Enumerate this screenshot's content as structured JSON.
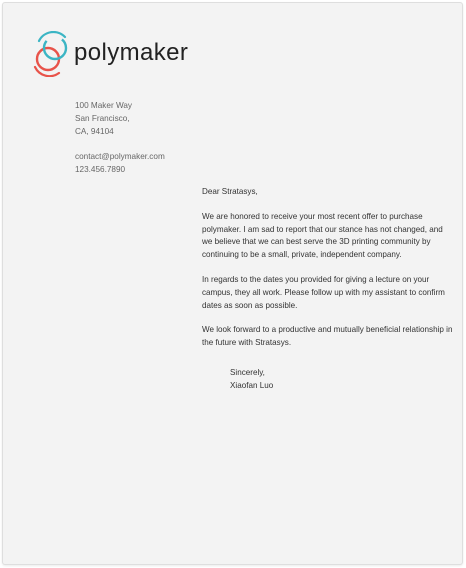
{
  "brand": {
    "name": "polymaker",
    "logo_colors": [
      "#e8534a",
      "#3bb5c4"
    ]
  },
  "address": {
    "line1": "100 Maker Way",
    "line2": "San Francisco,",
    "line3": "CA, 94104"
  },
  "contact": {
    "email": "contact@polymaker.com",
    "phone": "123.456.7890"
  },
  "letter": {
    "greeting": "Dear Stratasys,",
    "paragraphs": [
      [
        "We are honored to receive your most recent offer to purchase",
        "polymaker.  I am sad to report that our stance has not changed, and",
        "we believe that we can best serve the 3D printing community by",
        "continuing to be a small, private, independent company."
      ],
      [
        "In regards to the dates you provided for giving a lecture on your",
        "campus, they all work. Please follow up with my assistant to confirm",
        "dates as soon as possible."
      ],
      [
        "We look forward to a productive and mutually beneficial relationship in",
        "the future with Stratasys."
      ]
    ],
    "closing": "Sincerely,",
    "signature": "Xiaofan Luo"
  }
}
